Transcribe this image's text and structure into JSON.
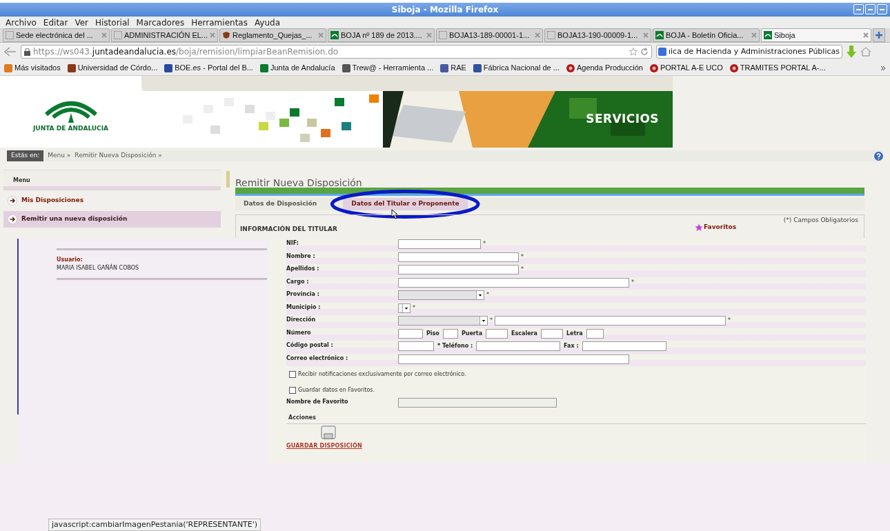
{
  "window": {
    "title": "Siboja - Mozilla Firefox"
  },
  "menu_bar": [
    "Archivo",
    "Editar",
    "Ver",
    "Historial",
    "Marcadores",
    "Herramientas",
    "Ayuda"
  ],
  "tabs": [
    {
      "label": "Sede electrónica del ...",
      "selected": false
    },
    {
      "label": "ADMINISTRACIÓN EL...",
      "selected": false
    },
    {
      "label": "Reglamento_Quejas_...",
      "selected": false
    },
    {
      "label": "BOJA nº 189 de 2013....",
      "selected": false
    },
    {
      "label": "BOJA13-189-00001-1...",
      "selected": false
    },
    {
      "label": "BOJA13-190-00009-1...",
      "selected": false
    },
    {
      "label": "BOJA - Boletín Oficia...",
      "selected": false
    },
    {
      "label": "Siboja",
      "selected": true
    }
  ],
  "address_bar": {
    "url": "https://ws043.**juntadeandalucia.es**/boja/remision/limpiarBeanRemision.do"
  },
  "search_field": {
    "value": "ıica de Hacienda y Administraciones Públicas"
  },
  "bookmarks": [
    "Más visitados",
    "Universidad de Córdo...",
    "BOE.es - Portal del B...",
    "Junta de Andalucía",
    "Trew@ - Herramienta ...",
    "RAE",
    "Fábrica Nacional de ...",
    "Agenda Producción",
    "PORTAL A-E UCO",
    "TRAMITES PORTAL A-..."
  ],
  "header": {
    "logo_text": "JUNTA DE ANDALUCIA",
    "banner_text": "SERVICIOS"
  },
  "breadcrumb": {
    "label": "Estás en:",
    "items": [
      "Menu »",
      "Remitir Nueva Disposición »"
    ]
  },
  "side_menu": {
    "title": "Menu",
    "items": [
      {
        "label": "Mis Disposiciones",
        "selected": false
      },
      {
        "label": "Remitir una nueva disposición",
        "selected": true
      }
    ]
  },
  "user": {
    "label": "Usuario:",
    "name": "MARIA ISABEL GAÑÁN COBOS"
  },
  "heading": "Remitir Nueva Disposición",
  "form_tabs": [
    {
      "label": "Datos de Disposición",
      "selected": false
    },
    {
      "label": "Datos del Titular o Proponente",
      "selected": true
    }
  ],
  "section": {
    "title": "INFORMACIÓN DEL TITULAR",
    "required_note": "(*) Campos Obligatorios",
    "favorites": "Favoritos"
  },
  "fields": [
    {
      "label": "NIF:",
      "controls": [
        {
          "kind": "input",
          "suffix": "*"
        }
      ]
    },
    {
      "label": "Nombre :",
      "controls": [
        {
          "kind": "input",
          "suffix": "*"
        }
      ]
    },
    {
      "label": "Apellidos :",
      "controls": [
        {
          "kind": "input",
          "suffix": "*"
        }
      ]
    },
    {
      "label": "Cargo :",
      "controls": [
        {
          "kind": "input",
          "suffix": "*"
        }
      ]
    },
    {
      "label": "Provincia :",
      "controls": [
        {
          "kind": "select",
          "disabled": true,
          "suffix": "*"
        }
      ]
    },
    {
      "label": "Municipio :",
      "controls": [
        {
          "kind": "select",
          "disabled": false,
          "suffix": "*"
        }
      ]
    },
    {
      "label": "Dirección",
      "controls": [
        {
          "kind": "select",
          "disabled": true,
          "suffix": "*"
        },
        {
          "kind": "input",
          "suffix": "*"
        }
      ]
    },
    {
      "label": "Número",
      "controls": [
        {
          "kind": "input"
        },
        {
          "kind": "text",
          "text": "Piso"
        },
        {
          "kind": "input"
        },
        {
          "kind": "text",
          "text": "Puerta"
        },
        {
          "kind": "input"
        },
        {
          "kind": "text",
          "text": "Escalera"
        },
        {
          "kind": "input"
        },
        {
          "kind": "text",
          "text": "Letra"
        },
        {
          "kind": "input"
        }
      ]
    },
    {
      "label": "Código postal :",
      "controls": [
        {
          "kind": "input"
        },
        {
          "kind": "text",
          "text": "* Teléfono :"
        },
        {
          "kind": "input"
        },
        {
          "kind": "text",
          "text": "Fax :"
        },
        {
          "kind": "input"
        }
      ]
    },
    {
      "label": "Correo electrónico :",
      "controls": [
        {
          "kind": "input"
        }
      ]
    }
  ],
  "checkboxes": [
    {
      "label": "Recibir notificaciones exclusivamente por correo electrónico.",
      "checked": false
    },
    {
      "label": "Guardar datos en Favoritos.",
      "checked": false
    }
  ],
  "favorite_name": {
    "label": "Nombre de Favorito",
    "disabled": true
  },
  "actions": {
    "title": "Acciones",
    "save_link": "GUARDAR DISPOSICIÓN"
  },
  "status_text": "javascript:cambiarImagenPestania('REPRESENTANTE')"
}
